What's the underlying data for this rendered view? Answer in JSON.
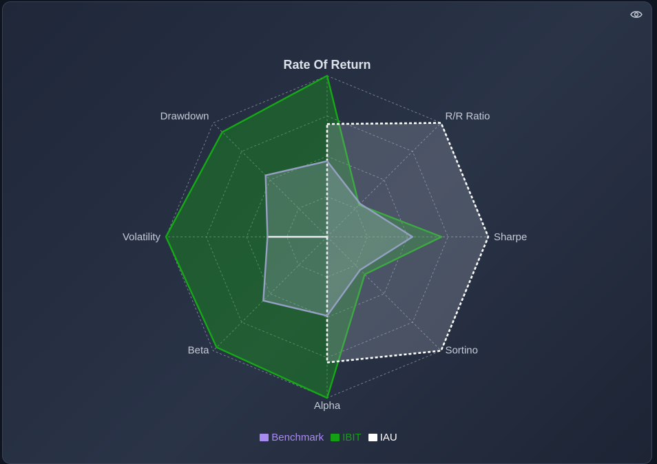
{
  "header": {
    "eye_icon": "eye-icon"
  },
  "chart_data": {
    "type": "radar",
    "axes": [
      "Rate Of Return",
      "R/R Ratio",
      "Sharpe",
      "Sortino",
      "Alpha",
      "Beta",
      "Volatility",
      "Drawdown"
    ],
    "range": [
      0,
      1
    ],
    "grid": true,
    "grid_levels": 4,
    "legend_position": "bottom",
    "series": [
      {
        "name": "Benchmark",
        "color": "#a98bf0",
        "line_color": "#95a0c4",
        "fill_opacity": 0.25,
        "dashed": false,
        "values": [
          0.47,
          0.29,
          0.53,
          0.29,
          0.49,
          0.56,
          0.37,
          0.54
        ]
      },
      {
        "name": "IBIT",
        "color": "#14a014",
        "line_color": "#16a816",
        "fill_opacity": 0.38,
        "dashed": false,
        "values": [
          1.0,
          0.28,
          0.71,
          0.33,
          1.0,
          0.97,
          1.0,
          0.92
        ]
      },
      {
        "name": "IAU",
        "color": "#ffffff",
        "line_color": "#ffffff",
        "fill_opacity": 0.28,
        "dashed": true,
        "values": [
          0.7,
          1.0,
          1.0,
          1.0,
          0.78,
          0.0,
          0.37,
          0.0
        ]
      }
    ]
  }
}
